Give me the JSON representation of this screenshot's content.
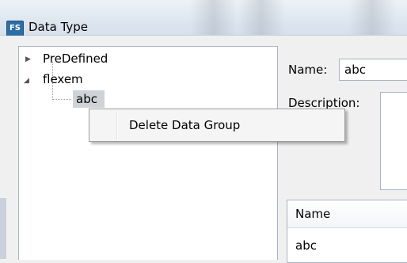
{
  "window": {
    "title": "Data Type",
    "icon_label": "FS"
  },
  "tree": {
    "nodes": [
      {
        "label": "PreDefined",
        "expander": "collapsed"
      },
      {
        "label": "flexem",
        "expander": "expanded"
      },
      {
        "label": "abc",
        "selected": true
      }
    ]
  },
  "form": {
    "name_label": "Name:",
    "name_value": "abc",
    "description_label": "Description:"
  },
  "grid": {
    "header": "Name",
    "rows": [
      "abc"
    ]
  },
  "context_menu": {
    "items": [
      "Delete Data Group"
    ]
  }
}
